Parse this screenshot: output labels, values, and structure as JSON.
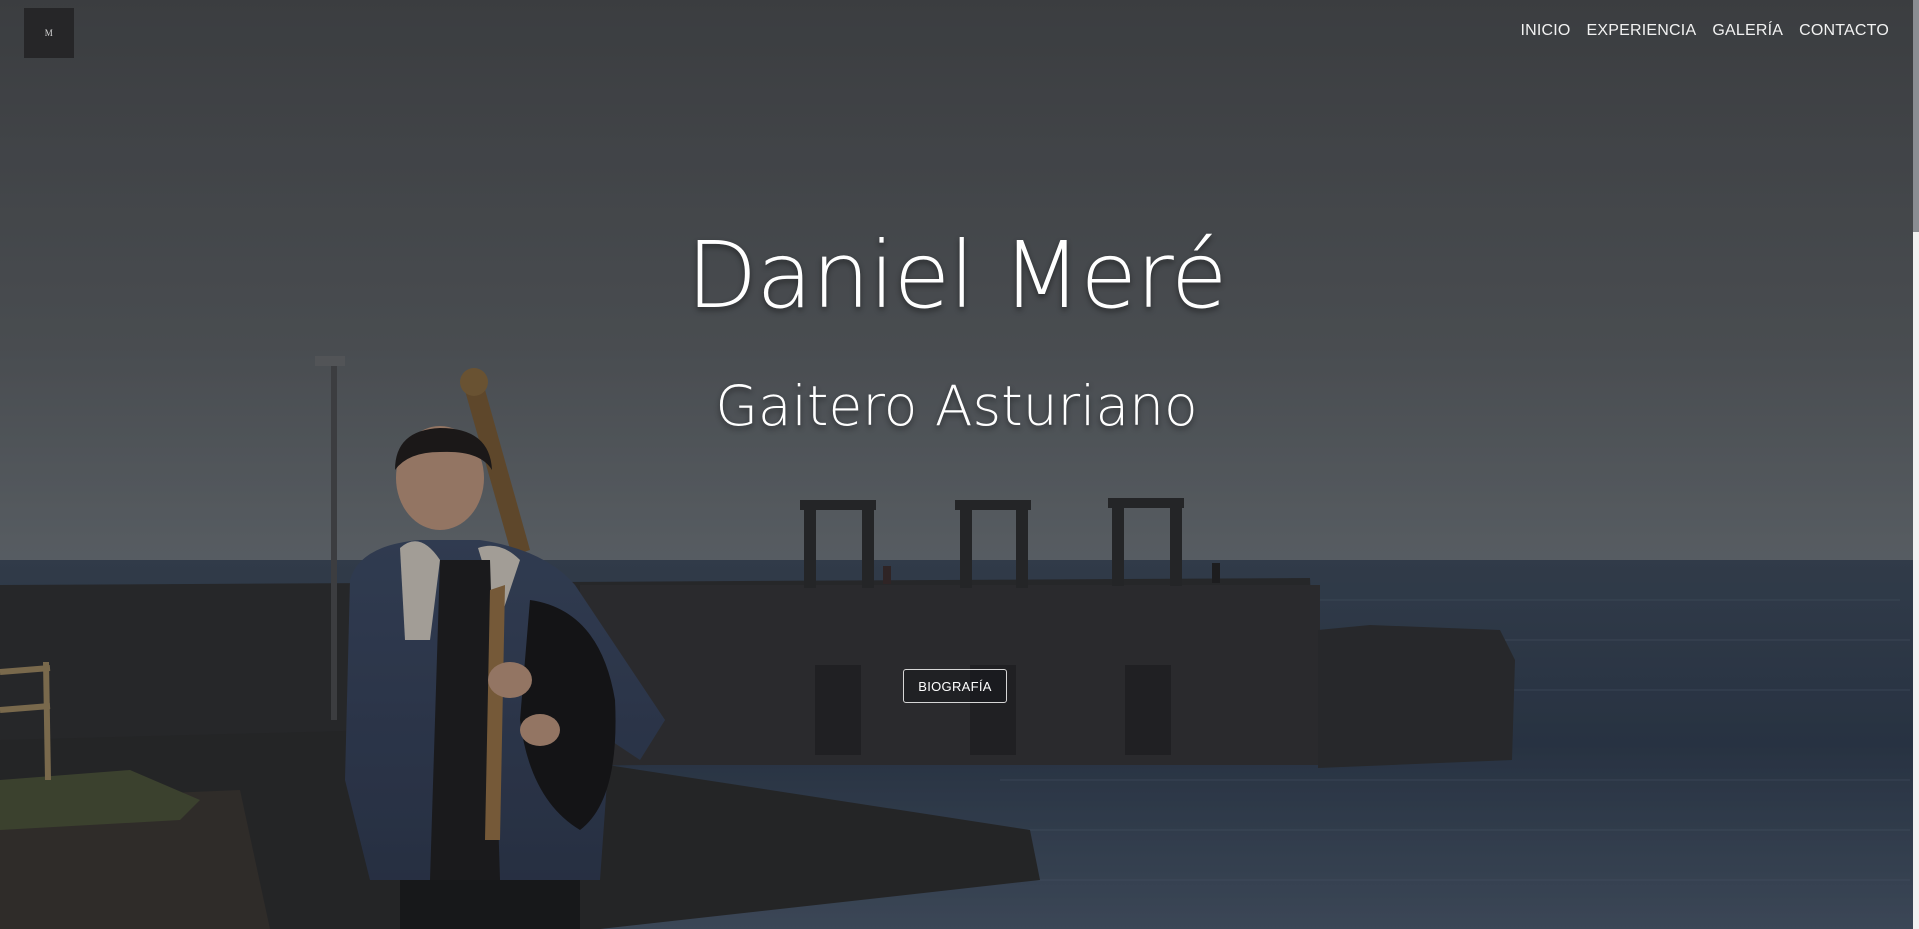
{
  "header": {
    "logo_text": "M",
    "nav": [
      {
        "label": "INICIO"
      },
      {
        "label": "EXPERIENCIA"
      },
      {
        "label": "GALERÍA"
      },
      {
        "label": "CONTACTO"
      }
    ]
  },
  "hero": {
    "title": "Daniel Meré",
    "subtitle": "Gaitero Asturiano",
    "button_label": "BIOGRAFÍA",
    "background_image": "bagpiper-seaside-pier-photo"
  },
  "colors": {
    "sky_top": "#4c4f52",
    "sky_horizon": "#6e7478",
    "sea": "#2c3a4d",
    "text": "#ffffff",
    "logo_bg": "#262628"
  }
}
